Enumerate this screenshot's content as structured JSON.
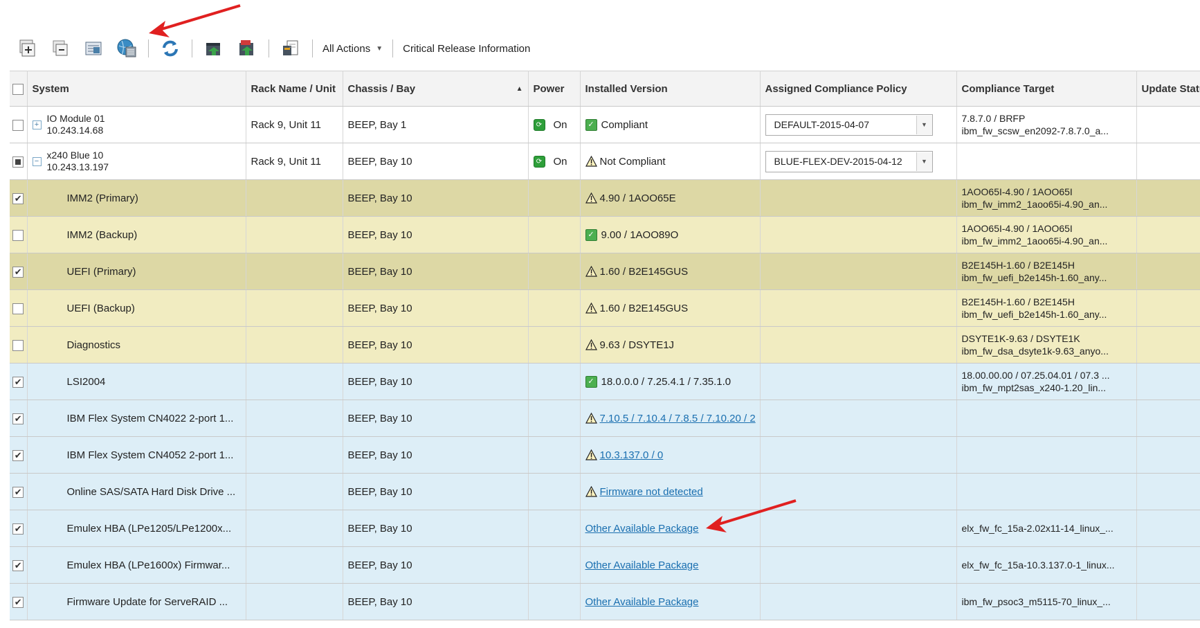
{
  "toolbar": {
    "buttons": [
      {
        "name": "expand-all-icon"
      },
      {
        "name": "collapse-all-icon"
      },
      {
        "name": "inventory-icon"
      },
      {
        "name": "globe-update-icon"
      },
      {
        "name": "refresh-icon"
      },
      {
        "name": "export-icon"
      },
      {
        "name": "import-icon"
      },
      {
        "name": "report-icon"
      }
    ],
    "all_actions_label": "All Actions",
    "critical_release_label": "Critical Release Information"
  },
  "table": {
    "columns": [
      "System",
      "Rack Name / Unit",
      "Chassis / Bay",
      "Power",
      "Installed Version",
      "Assigned Compliance Policy",
      "Compliance Target",
      "Update Statu"
    ],
    "rows": [
      {
        "style": "white",
        "checkbox": "unchecked",
        "expander": "+",
        "system": [
          "IO Module 01",
          "10.243.14.68"
        ],
        "rack": "Rack 9, Unit 11",
        "chassis": "BEEP, Bay 1",
        "power": "On",
        "status_icon": "ok",
        "installed": "Compliant",
        "installed_link": false,
        "policy": "DEFAULT-2015-04-07",
        "target": [
          "7.8.7.0 / BRFP",
          "ibm_fw_scsw_en2092-7.8.7.0_a..."
        ]
      },
      {
        "style": "white",
        "checkbox": "partial",
        "expander": "−",
        "system": [
          "x240 Blue 10",
          "10.243.13.197"
        ],
        "rack": "Rack 9, Unit 11",
        "chassis": "BEEP, Bay 10",
        "power": "On",
        "status_icon": "warn",
        "installed": "Not Compliant",
        "installed_link": false,
        "policy": "BLUE-FLEX-DEV-2015-04-12",
        "target": []
      },
      {
        "style": "yellow-sel",
        "checkbox": "checked",
        "system": [
          "IMM2 (Primary)"
        ],
        "rack": "",
        "chassis": "BEEP, Bay 10",
        "power": "",
        "status_icon": "warn",
        "installed": "4.90 / 1AOO65E",
        "installed_link": false,
        "policy": "",
        "target": [
          "1AOO65I-4.90 / 1AOO65I",
          "ibm_fw_imm2_1aoo65i-4.90_an..."
        ]
      },
      {
        "style": "yellow",
        "checkbox": "unchecked",
        "system": [
          "IMM2 (Backup)"
        ],
        "rack": "",
        "chassis": "BEEP, Bay 10",
        "power": "",
        "status_icon": "ok",
        "installed": "9.00 / 1AOO89O",
        "installed_link": false,
        "policy": "",
        "target": [
          "1AOO65I-4.90 / 1AOO65I",
          "ibm_fw_imm2_1aoo65i-4.90_an..."
        ]
      },
      {
        "style": "yellow-sel",
        "checkbox": "checked",
        "system": [
          "UEFI (Primary)"
        ],
        "rack": "",
        "chassis": "BEEP, Bay 10",
        "power": "",
        "status_icon": "warn",
        "installed": "1.60 / B2E145GUS",
        "installed_link": false,
        "policy": "",
        "target": [
          "B2E145H-1.60 / B2E145H",
          "ibm_fw_uefi_b2e145h-1.60_any..."
        ]
      },
      {
        "style": "yellow",
        "checkbox": "unchecked",
        "system": [
          "UEFI (Backup)"
        ],
        "rack": "",
        "chassis": "BEEP, Bay 10",
        "power": "",
        "status_icon": "warn",
        "installed": "1.60 / B2E145GUS",
        "installed_link": false,
        "policy": "",
        "target": [
          "B2E145H-1.60 / B2E145H",
          "ibm_fw_uefi_b2e145h-1.60_any..."
        ]
      },
      {
        "style": "yellow",
        "checkbox": "unchecked",
        "system": [
          "Diagnostics"
        ],
        "rack": "",
        "chassis": "BEEP, Bay 10",
        "power": "",
        "status_icon": "warn",
        "installed": "9.63 / DSYTE1J",
        "installed_link": false,
        "policy": "",
        "target": [
          "DSYTE1K-9.63 / DSYTE1K",
          "ibm_fw_dsa_dsyte1k-9.63_anyo..."
        ]
      },
      {
        "style": "blue",
        "checkbox": "checked",
        "system": [
          "LSI2004"
        ],
        "rack": "",
        "chassis": "BEEP, Bay 10",
        "power": "",
        "status_icon": "ok",
        "installed": "18.0.0.0 / 7.25.4.1 / 7.35.1.0",
        "installed_link": false,
        "policy": "",
        "target": [
          "18.00.00.00 / 07.25.04.01 / 07.3 ...",
          "ibm_fw_mpt2sas_x240-1.20_lin..."
        ]
      },
      {
        "style": "blue",
        "checkbox": "checked",
        "system": [
          "IBM Flex System CN4022 2-port 1..."
        ],
        "rack": "",
        "chassis": "BEEP, Bay 10",
        "power": "",
        "status_icon": "warn",
        "installed": "7.10.5 / 7.10.4 / 7.8.5 / 7.10.20 / 2",
        "installed_link": true,
        "policy": "",
        "target": []
      },
      {
        "style": "blue",
        "checkbox": "checked",
        "system": [
          "IBM Flex System CN4052 2-port 1..."
        ],
        "rack": "",
        "chassis": "BEEP, Bay 10",
        "power": "",
        "status_icon": "warn",
        "installed": "10.3.137.0 / 0",
        "installed_link": true,
        "policy": "",
        "target": []
      },
      {
        "style": "blue",
        "checkbox": "checked",
        "system": [
          "Online SAS/SATA Hard Disk Drive ..."
        ],
        "rack": "",
        "chassis": "BEEP, Bay 10",
        "power": "",
        "status_icon": "warn",
        "installed": "Firmware not detected",
        "installed_link": true,
        "policy": "",
        "target": []
      },
      {
        "style": "blue",
        "checkbox": "checked",
        "system": [
          "Emulex HBA (LPe1205/LPe1200x..."
        ],
        "rack": "",
        "chassis": "BEEP, Bay 10",
        "power": "",
        "status_icon": "none",
        "installed": "Other Available Package",
        "installed_link": true,
        "policy": "",
        "target": [
          "elx_fw_fc_15a-2.02x11-14_linux_..."
        ]
      },
      {
        "style": "blue",
        "checkbox": "checked",
        "system": [
          "Emulex HBA (LPe1600x) Firmwar..."
        ],
        "rack": "",
        "chassis": "BEEP, Bay 10",
        "power": "",
        "status_icon": "none",
        "installed": "Other Available Package",
        "installed_link": true,
        "policy": "",
        "target": [
          "elx_fw_fc_15a-10.3.137.0-1_linux..."
        ]
      },
      {
        "style": "blue",
        "checkbox": "checked",
        "system": [
          "Firmware Update for ServeRAID ..."
        ],
        "rack": "",
        "chassis": "BEEP, Bay 10",
        "power": "",
        "status_icon": "none",
        "installed": "Other Available Package",
        "installed_link": true,
        "policy": "",
        "target": [
          "ibm_fw_psoc3_m5115-70_linux_..."
        ]
      }
    ]
  },
  "colors": {
    "annotation_arrow": "#e02020",
    "link": "#1a6fb0",
    "row_yellow": "#f1ecc1",
    "row_yellow_selected": "#ddd8a5",
    "row_blue": "#ddeef7"
  }
}
